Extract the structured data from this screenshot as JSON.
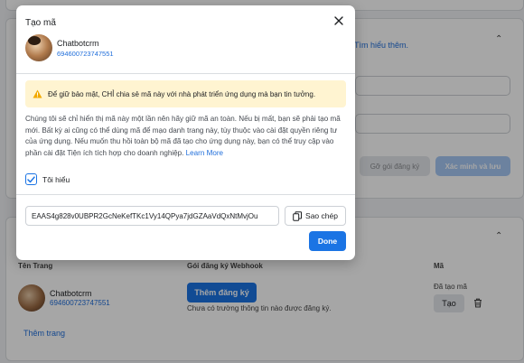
{
  "background": {
    "learn_more": "Tìm hiểu thêm.",
    "register_package": "Gỡ gói đăng ký",
    "verify_save": "Xác minh và lưu",
    "table": {
      "col_page": "Tên Trang",
      "col_webhook": "Gói đăng ký Webhook",
      "col_token": "Mã",
      "row": {
        "name": "Chatbotcrm",
        "id": "694600723747551",
        "subscribe": "Thêm đăng ký",
        "note": "Chưa có trường thông tin nào được đăng ký.",
        "created": "Đã tạo mã",
        "create": "Tạo"
      },
      "add_page": "Thêm trang"
    }
  },
  "dialog": {
    "title": "Tạo mã",
    "account": {
      "name": "Chatbotcrm",
      "id": "694600723747551"
    },
    "warning": "Để giữ bảo mật, CHỈ chia sẻ mã này với nhà phát triển ứng dụng mà bạn tin tưởng.",
    "description": "Chúng tôi sẽ chỉ hiển thị mã này một lần nên hãy giữ mã an toàn. Nếu bị mất, bạn sẽ phải tạo mã mới. Bất kỳ ai cũng có thể dùng mã để mạo danh trang này, tùy thuộc vào cài đặt quyền riêng tư của ứng dụng. Nếu muốn thu hồi toàn bộ mã đã tạo cho ứng dụng này, bạn có thể truy cập vào phần cài đặt Tiện ích tích hợp cho doanh nghiệp.",
    "learn_more": "Learn More",
    "checkbox_label": "Tôi hiểu",
    "token": "EAAS4g828v0UBPR2GcNeKefTKc1Vy14QPya7jdGZAaVdQxNtMvjOu",
    "copy_label": "Sao chép",
    "done_label": "Done"
  },
  "colors": {
    "accent": "#1b74e4",
    "warning_bg": "#fff4d1",
    "link": "#216fdb"
  },
  "icons": [
    "close-icon",
    "warning-icon",
    "checkmark-icon",
    "copy-icon",
    "trash-icon",
    "chevron-up-icon"
  ]
}
